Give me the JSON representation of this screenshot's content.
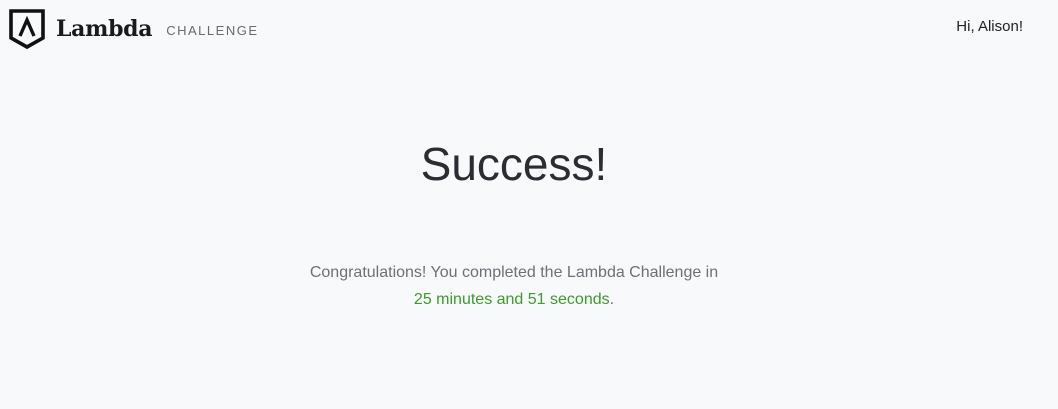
{
  "header": {
    "brand": "Lambda",
    "brand_sub": "CHALLENGE",
    "greeting": "Hi, Alison!"
  },
  "main": {
    "title": "Success!",
    "message_line1": "Congratulations! You completed the Lambda Challenge in",
    "time": "25 minutes and 51 seconds",
    "period": "."
  },
  "colors": {
    "background": "#f8f9fb",
    "accent_green": "#3f9a2f",
    "text_muted": "#6d7076",
    "title": "#2a2d31"
  },
  "icons": {
    "logo": "lambda-shield-icon"
  }
}
